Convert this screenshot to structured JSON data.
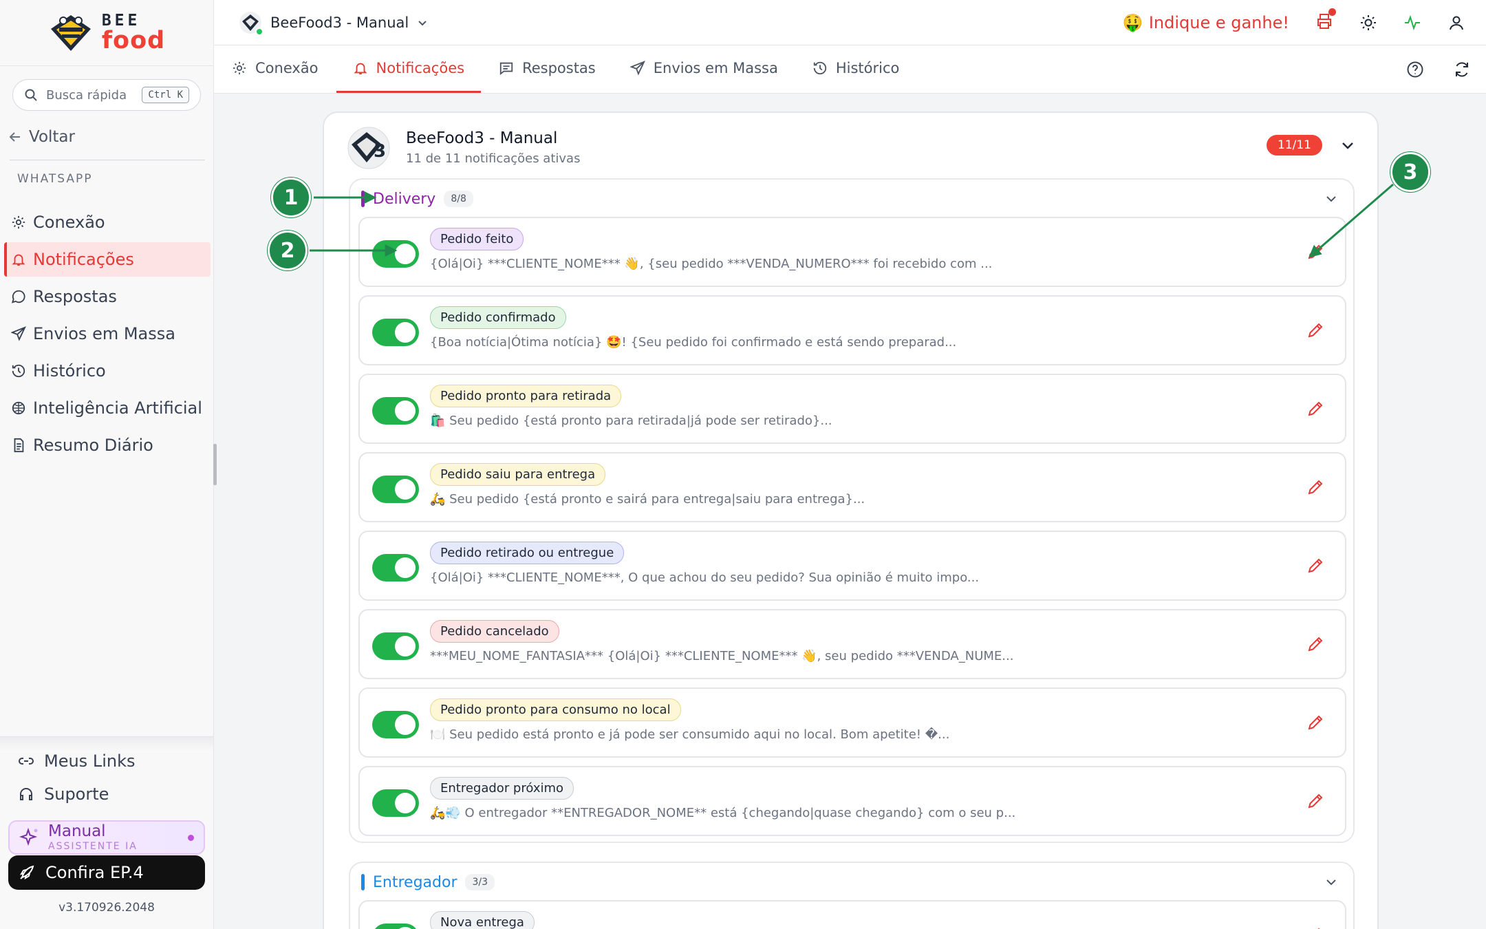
{
  "sidebar": {
    "logo_top": "BEE",
    "logo_bottom": "food",
    "search_placeholder": "Busca rápida",
    "search_shortcut": "Ctrl K",
    "back_label": "Voltar",
    "section_title": "WHATSAPP",
    "items": [
      {
        "label": "Conexão",
        "icon": "gear-icon"
      },
      {
        "label": "Notificações",
        "icon": "bell-icon",
        "active": true
      },
      {
        "label": "Respostas",
        "icon": "chat-icon"
      },
      {
        "label": "Envios em Massa",
        "icon": "send-icon"
      },
      {
        "label": "Histórico",
        "icon": "history-icon"
      },
      {
        "label": "Inteligência Artificial",
        "icon": "brain-icon"
      },
      {
        "label": "Resumo Diário",
        "icon": "document-icon"
      }
    ],
    "links": [
      {
        "label": "Meus Links",
        "icon": "link-icon"
      },
      {
        "label": "Suporte",
        "icon": "headset-icon"
      }
    ],
    "assistant": {
      "title": "Manual",
      "subtitle": "ASSISTENTE IA"
    },
    "promo_label": "Confira EP.4",
    "version": "v3.170926.2048"
  },
  "topbar": {
    "store_name": "BeeFood3 - Manual",
    "refer_label": "Indique e ganhe!",
    "icons": [
      "printer-icon",
      "sun-icon",
      "activity-icon",
      "user-icon"
    ]
  },
  "tabs": [
    {
      "label": "Conexão",
      "icon": "gear-icon"
    },
    {
      "label": "Notificações",
      "icon": "bell-icon",
      "active": true
    },
    {
      "label": "Respostas",
      "icon": "message-icon"
    },
    {
      "label": "Envios em Massa",
      "icon": "send-icon"
    },
    {
      "label": "Histórico",
      "icon": "history-icon"
    }
  ],
  "panel": {
    "title": "BeeFood3 - Manual",
    "subtitle": "11 de 11 notificações ativas",
    "count": "11/11"
  },
  "groups": [
    {
      "name": "Delivery",
      "count": "8/8",
      "color": "#8e24aa",
      "notifications": [
        {
          "label": "Pedido feito",
          "enabled": true,
          "pill_bg": "#efe3fb",
          "pill_border": "#c9a6ea",
          "preview": "{Olá|Oi} ***CLIENTE_NOME*** 👋, {seu pedido ***VENDA_NUMERO*** foi recebido com ..."
        },
        {
          "label": "Pedido confirmado",
          "enabled": true,
          "pill_bg": "#e3f6e6",
          "pill_border": "#9bd8a6",
          "preview": "{Boa notícia|Ótima notícia} 🤩! {Seu pedido foi confirmado e está sendo preparad..."
        },
        {
          "label": "Pedido pronto para retirada",
          "enabled": true,
          "pill_bg": "#fdf7d8",
          "pill_border": "#e8d98a",
          "preview": "🛍️ Seu pedido {está pronto para retirada|já pode ser retirado}..."
        },
        {
          "label": "Pedido saiu para entrega",
          "enabled": true,
          "pill_bg": "#fdf7d8",
          "pill_border": "#e8d98a",
          "preview": "🛵 Seu pedido {está pronto e sairá para entrega|saiu para entrega}..."
        },
        {
          "label": "Pedido retirado ou entregue",
          "enabled": true,
          "pill_bg": "#e6e9fb",
          "pill_border": "#adb6ee",
          "preview": "{Olá|Oi} ***CLIENTE_NOME***, O que achou do seu pedido? Sua opinião é muito impo..."
        },
        {
          "label": "Pedido cancelado",
          "enabled": true,
          "pill_bg": "#fde4e4",
          "pill_border": "#f0a9a9",
          "preview": "***MEU_NOME_FANTASIA*** {Olá|Oi} ***CLIENTE_NOME*** 👋, seu pedido ***VENDA_NUME..."
        },
        {
          "label": "Pedido pronto para consumo no local",
          "enabled": true,
          "pill_bg": "#fdf7d8",
          "pill_border": "#e8d98a",
          "preview": "🍽️ Seu pedido está pronto e já pode ser consumido aqui no local. Bom apetite! �..."
        },
        {
          "label": "Entregador próximo",
          "enabled": true,
          "pill_bg": "#f1f2f4",
          "pill_border": "#c9ccd1",
          "preview": "🛵💨 O entregador **ENTREGADOR_NOME** está {chegando|quase chegando} com o seu p..."
        }
      ]
    },
    {
      "name": "Entregador",
      "count": "3/3",
      "color": "#1e88e5",
      "notifications": [
        {
          "label": "Nova entrega",
          "enabled": true,
          "pill_bg": "#f1f2f4",
          "pill_border": "#c9ccd1",
          "preview": ""
        }
      ]
    }
  ],
  "annotations": [
    "1",
    "2",
    "3"
  ]
}
